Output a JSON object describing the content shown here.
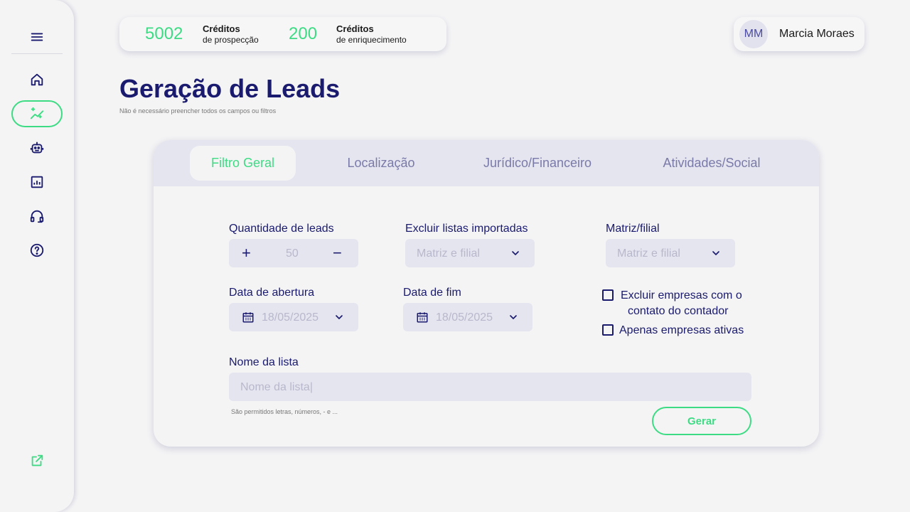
{
  "credits": {
    "prospect_value": "5002",
    "prospect_title": "Créditos",
    "prospect_sub": "de prospecção",
    "enrich_value": "200",
    "enrich_title": "Créditos",
    "enrich_sub": "de enriquecimento"
  },
  "user": {
    "initials": "MM",
    "name": "Marcia Moraes"
  },
  "page": {
    "title": "Geração de Leads",
    "subtitle": "Não é necessário preencher todos os campos ou filtros"
  },
  "tabs": [
    {
      "label": "Filtro Geral",
      "active": true
    },
    {
      "label": "Localização",
      "active": false
    },
    {
      "label": "Jurídico/Financeiro",
      "active": false
    },
    {
      "label": "Atividades/Social",
      "active": false
    }
  ],
  "form": {
    "quantity_label": "Quantidade de leads",
    "quantity_value": "50",
    "quantity_plus": "+",
    "quantity_minus": "−",
    "exclude_lists_label": "Excluir listas importadas",
    "exclude_lists_placeholder": "Matriz e filial",
    "matriz_label": "Matriz/filial",
    "matriz_placeholder": "Matriz e filial",
    "open_date_label": "Data de abertura",
    "open_date_placeholder": "18/05/2025",
    "end_date_label": "Data de fim",
    "end_date_placeholder": "18/05/2025",
    "exclude_accountant_label_1": "Excluir empresas com o",
    "exclude_accountant_label_2": "contato do contador",
    "only_active_label": "Apenas empresas ativas",
    "list_name_label": "Nome da lista",
    "list_name_placeholder": "Nome da lista|",
    "list_name_hint": "São permitidos letras, números, - e ...",
    "submit_label": "Gerar"
  },
  "sidebar": {
    "items": [
      "menu-icon",
      "home-icon",
      "sparkle-chart-icon",
      "robot-icon",
      "report-icon",
      "headset-icon",
      "help-icon",
      "external-link-icon"
    ]
  },
  "colors": {
    "primary": "#1a1a6e",
    "accent": "#3ddc84",
    "field_bg": "#e5e5f0",
    "bg": "#f4f4f5"
  }
}
